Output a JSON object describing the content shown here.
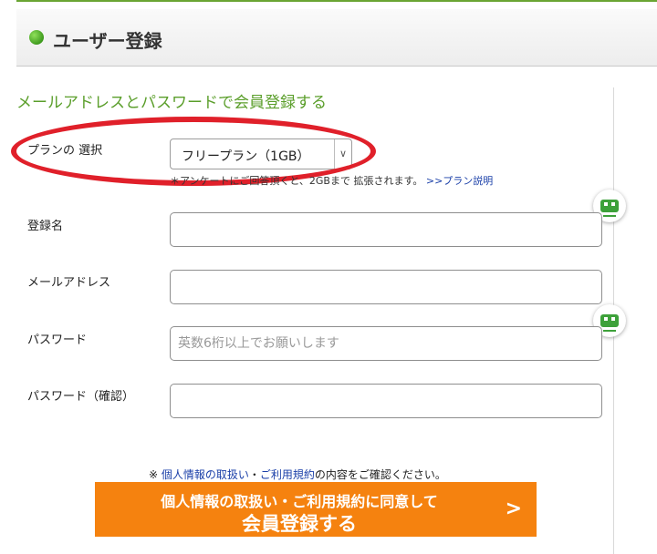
{
  "header": {
    "title": "ユーザー登録"
  },
  "subtitle": "メールアドレスとパスワードで会員登録する",
  "plan": {
    "label": "プランの 選択",
    "selected": "フリープラン（1GB）",
    "note_text": "＊アンケートにご回答頂くと、2GBまで 拡張されます。",
    "note_link": ">>プラン説明"
  },
  "fields": {
    "name_label": "登録名",
    "email_label": "メールアドレス",
    "password_label": "パスワード",
    "password_placeholder": "英数6桁以上でお願いします",
    "password_confirm_label": "パスワード（確認）"
  },
  "agreement": {
    "prefix": "※ ",
    "privacy_link": "個人情報の取扱い",
    "separator": "・",
    "terms_link": "ご利用規約",
    "suffix": "の内容をご確認ください。"
  },
  "cta": {
    "line1": "個人情報の取扱い・ご利用規約に同意して",
    "line2": "会員登録する",
    "arrow": ">"
  },
  "colors": {
    "accent_green": "#5a9e2a",
    "highlight_red": "#e0202a",
    "cta_orange": "#f5820f",
    "link_blue": "#1a3fa8"
  }
}
